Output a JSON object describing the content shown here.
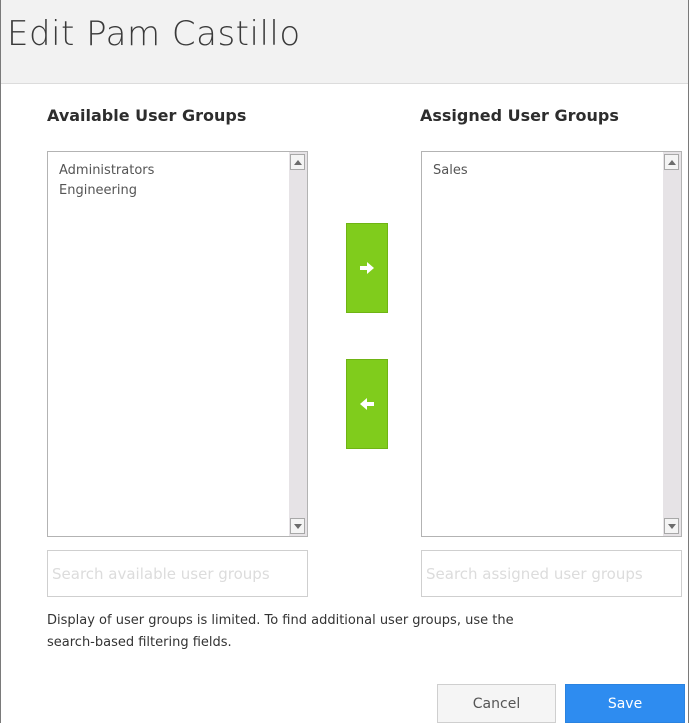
{
  "dialog": {
    "title": "Edit Pam Castillo"
  },
  "available": {
    "label": "Available User Groups",
    "items": [
      "Administrators",
      "Engineering"
    ],
    "search_placeholder": "Search available user groups"
  },
  "assigned": {
    "label": "Assigned User Groups",
    "items": [
      "Sales"
    ],
    "search_placeholder": "Search assigned user groups"
  },
  "actions": {
    "move_right_icon": "arrow-right-icon",
    "move_left_icon": "arrow-left-icon",
    "button_color": "#80cc1c"
  },
  "hint": {
    "line1": "Display of user groups is limited. To find additional user groups, use the",
    "line2": "search-based filtering fields."
  },
  "footer": {
    "cancel_label": "Cancel",
    "save_label": "Save",
    "save_color": "#2e8cf0"
  }
}
